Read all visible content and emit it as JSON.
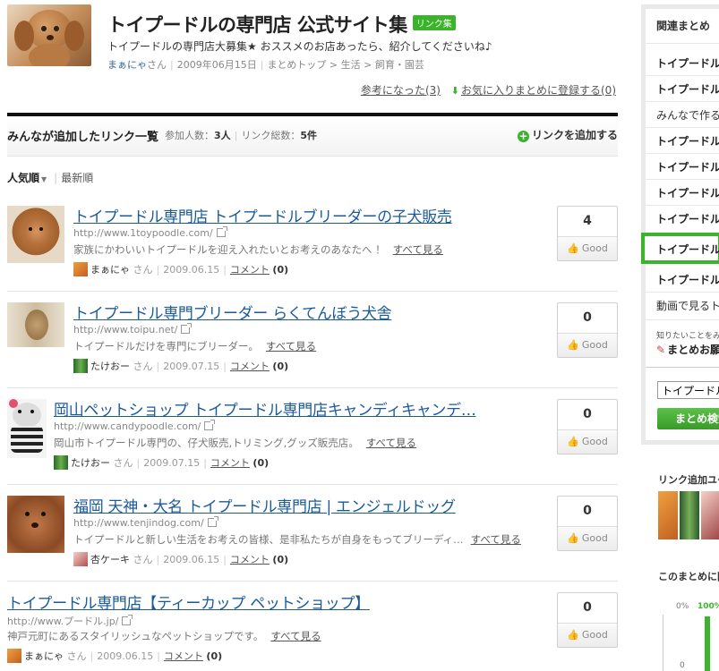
{
  "header": {
    "title": "トイプードルの専門店 公式サイト集",
    "badge": "リンク集",
    "description": "トイプードルの専門店大募集★ おススメのお店あったら、紹介してくださいね♪",
    "author": "まぁにゃ",
    "author_suffix": "さん",
    "date": "2009年06月15日",
    "breadcrumb": [
      "まとめトップ",
      "生活",
      "飼育・園芸"
    ],
    "helpful_label": "参考になった",
    "helpful_count": "(3)",
    "favorite_label": "お気に入りまとめに登録する",
    "favorite_count": "(0)"
  },
  "list_header": {
    "title": "みんなが追加したリンク一覧",
    "participants_label": "参加人数：",
    "participants": "3人",
    "links_label": "リンク総数：",
    "links": "5件",
    "add_label": "リンクを追加する"
  },
  "sort": {
    "popular": "人気順",
    "newest": "最新順"
  },
  "labels": {
    "see_all": "すべて見る",
    "comment": "コメント",
    "san": "さん",
    "good": "Good"
  },
  "items": [
    {
      "title": "トイプードル専門店 トイプードルブリーダーの子犬販売",
      "url": "http://www.1toypoodle.com/",
      "desc": "家族にかわいいトイプードルを迎え入れたいとお考えのあなたへ ！",
      "user": "まぁにゃ",
      "date": "2009.06.15",
      "comments": "(0)",
      "votes": "4"
    },
    {
      "title": "トイプードル専門ブリーダー らくてんぼう犬舎",
      "url": "http://www.toipu.net/",
      "desc": "トイプードルだけを専門にブリーダー。",
      "user": "たけおー",
      "date": "2009.07.15",
      "comments": "(0)",
      "votes": "0"
    },
    {
      "title": "岡山ペットショップ トイプードル専門店キャンディキャンデ…",
      "url": "http://www.candypoodle.com/",
      "desc": "岡山市トイプードル専門の、仔犬販売,トリミング,グッズ販売店。",
      "user": "たけおー",
      "date": "2009.07.15",
      "comments": "(0)",
      "votes": "0"
    },
    {
      "title": "福岡 天神・大名 トイプードル専門店 | エンジェルドッグ",
      "url": "http://www.tenjindog.com/",
      "desc": "トイプードルと新しい生活をお考えの皆様、是非私たちが自身をもってブリーディ…",
      "user": "杏ケーキ",
      "date": "2009.06.15",
      "comments": "(0)",
      "votes": "0"
    },
    {
      "title": "トイプードル専門店【ティーカップ ペットショップ】",
      "url": "http://www.プードル.jp/",
      "desc": "神戸元町にあるスタイリッシュなペットショップです。",
      "user": "まぁにゃ",
      "date": "2009.06.15",
      "comments": "(0)",
      "votes": "0"
    }
  ],
  "sidebar": {
    "title": "関連まとめ",
    "items": [
      "トイプードルの",
      "トイプードルの",
      "みんなで作る",
      "トイプードルの",
      "トイプードル",
      "トイプードル",
      "トイプードルの",
      "トイプードルの",
      "トイプードルの",
      "動画で見るトイ"
    ],
    "note": "知りたいことをみ",
    "make_label": "まとめお願",
    "search_value": "トイプードル",
    "search_button": "まとめ検索",
    "contributors_title": "リンク追加ユー",
    "chart_title": "このまとめに関",
    "chart_pct_left": "0%",
    "chart_pct_right": "100%",
    "chart_zero": "0"
  },
  "colors": {
    "link": "#1a5a9a",
    "accent_green": "#3bb42b",
    "good_orange": "#e07a2a"
  }
}
